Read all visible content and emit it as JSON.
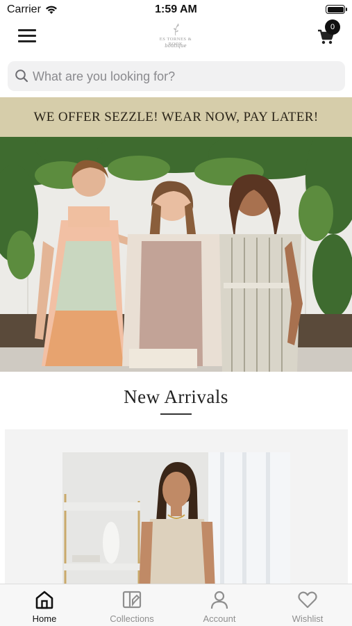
{
  "status_bar": {
    "carrier": "Carrier",
    "time": "1:59 AM"
  },
  "header": {
    "logo_name": "ES TORNES & BOOK",
    "logo_script": "boutique",
    "cart_count": "0"
  },
  "search": {
    "placeholder": "What are you looking for?"
  },
  "promo": {
    "text": "WE OFFER SEZZLE! WEAR NOW, PAY LATER!"
  },
  "section": {
    "title": "New Arrivals"
  },
  "tabs": [
    {
      "label": "Home",
      "icon": "home-icon",
      "active": true
    },
    {
      "label": "Collections",
      "icon": "collections-icon",
      "active": false
    },
    {
      "label": "Account",
      "icon": "account-icon",
      "active": false
    },
    {
      "label": "Wishlist",
      "icon": "heart-icon",
      "active": false
    }
  ],
  "colors": {
    "promo_bg": "#d6cdaa",
    "accent": "#111111"
  }
}
